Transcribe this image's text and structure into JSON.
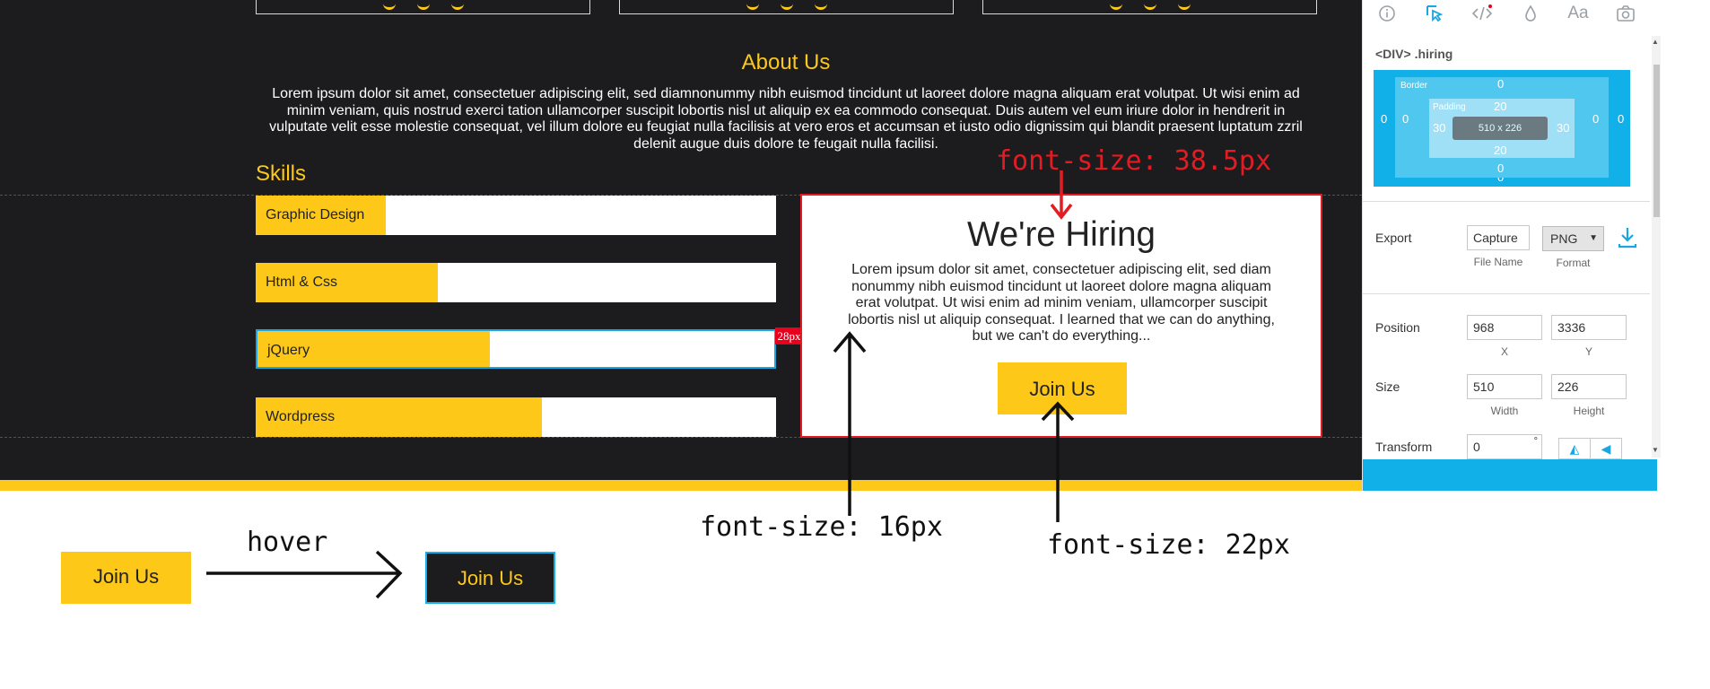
{
  "about": {
    "title": "About Us",
    "text": "Lorem ipsum dolor sit amet, consectetuer adipiscing elit, sed diamnonummy nibh euismod tincidunt ut laoreet dolore magna aliquam erat volutpat. Ut wisi enim ad minim veniam, quis nostrud exerci tation ullamcorper suscipit lobortis nisl ut aliquip ex ea commodo consequat. Duis autem vel eum iriure dolor in hendrerit in vulputate velit esse molestie consequat, vel illum dolore eu feugiat nulla facilisis at vero eros et accumsan et iusto odio dignissim qui blandit praesent luptatum zzril delenit augue duis dolore te feugait nulla facilisi."
  },
  "skills": {
    "title": "Skills",
    "items": [
      {
        "label": "Graphic Design",
        "level": 0.25
      },
      {
        "label": "Html & Css",
        "level": 0.35
      },
      {
        "label": "jQuery",
        "level": 0.45
      },
      {
        "label": "Wordpress",
        "level": 0.55
      }
    ]
  },
  "selection_badge": "28px",
  "hiring": {
    "title": "We're Hiring",
    "text": "Lorem ipsum dolor sit amet, consectetuer adipiscing elit, sed diam nonummy nibh euismod tincidunt ut laoreet dolore magna aliquam erat volutpat. Ut wisi enim ad minim veniam, ullamcorper suscipit lobortis nisl ut aliquip consequat. I learned that we can do anything, but we can't do everything...",
    "button": "Join Us"
  },
  "inspector": {
    "tabs": [
      "info-icon",
      "select-cursor-icon",
      "code-icon",
      "color-drop-icon",
      "typography-icon",
      "camera-icon"
    ],
    "typography_tab": "Aa",
    "selected": "<DIV> .hiring",
    "boxmodel": {
      "border_label": "Border",
      "padding_label": "Padding",
      "content_size": "510 x 226",
      "margin_left": "0",
      "margin_right": "0",
      "border_top": "0",
      "border_bottom": "0",
      "border_left": "0",
      "border_right": "0",
      "padding_top": "20",
      "padding_bottom": "20",
      "padding_left": "30",
      "padding_right": "30",
      "margin_bottom": "0"
    },
    "export": {
      "label": "Export",
      "file_name_value": "Capture",
      "file_name_caption": "File Name",
      "format_value": "PNG",
      "format_caption": "Format"
    },
    "position": {
      "label": "Position",
      "x": "968",
      "y": "3336",
      "x_caption": "X",
      "y_caption": "Y"
    },
    "size": {
      "label": "Size",
      "width": "510",
      "height": "226",
      "width_caption": "Width",
      "height_caption": "Height"
    },
    "transform": {
      "label": "Transform",
      "value": "0",
      "unit": "°"
    }
  },
  "annotations": {
    "title_font": "font-size: 38.5px",
    "body_font": "font-size: 16px",
    "button_font": "font-size: 22px",
    "hover": "hover"
  },
  "demo": {
    "before": "Join Us",
    "after": "Join Us"
  },
  "colors": {
    "accent": "#fdc818",
    "dark": "#1c1c1e",
    "highlight": "#e31b23",
    "inspector_blue": "#12b0e8"
  }
}
